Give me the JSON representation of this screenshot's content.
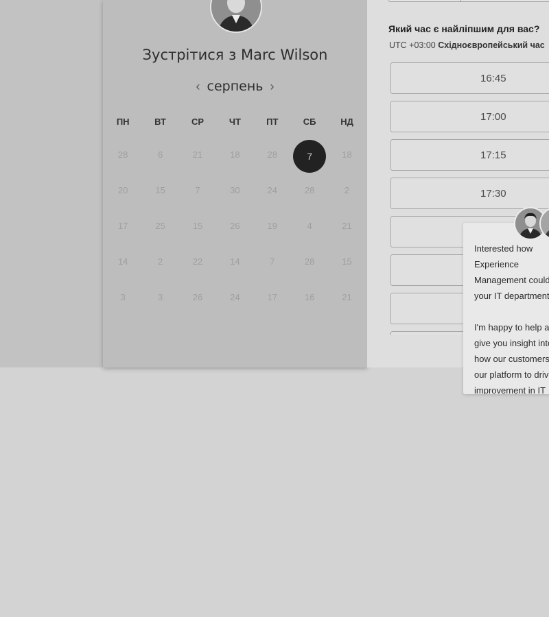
{
  "booking": {
    "title_prefix": "Зустрітися з",
    "host_name": "Marc Wilson",
    "month_label": "серпень",
    "prev_arrow": "‹",
    "next_arrow": "›",
    "weekdays": [
      "ПН",
      "ВТ",
      "СР",
      "ЧТ",
      "ПТ",
      "СБ",
      "НД"
    ],
    "days": [
      [
        "28",
        "6",
        "21",
        "18",
        "28",
        "7",
        "18"
      ],
      [
        "20",
        "15",
        "7",
        "30",
        "24",
        "28",
        "2"
      ],
      [
        "17",
        "25",
        "15",
        "26",
        "19",
        "4",
        "21"
      ],
      [
        "14",
        "2",
        "22",
        "14",
        "7",
        "28",
        "15"
      ],
      [
        "3",
        "3",
        "26",
        "24",
        "17",
        "16",
        "21"
      ]
    ],
    "selected_day": "7",
    "question": "Який час є найліпшим для вас?",
    "timezone_offset": "UTC +03:00",
    "timezone_name": "Східноєвропейський час",
    "time_slots": [
      "16:45",
      "17:00",
      "17:15",
      "17:30",
      "",
      "",
      "",
      ""
    ]
  },
  "chat": {
    "message": "Interested how Experience Management could help your IT department?\n\nI'm happy to help and give you insight into how our customers use our platform to drive improvement in IT productivity."
  },
  "colors": {
    "selected_day_bg": "#222222",
    "panel_bg": "#bdbdbd",
    "slot_border": "#a6a6a6"
  }
}
